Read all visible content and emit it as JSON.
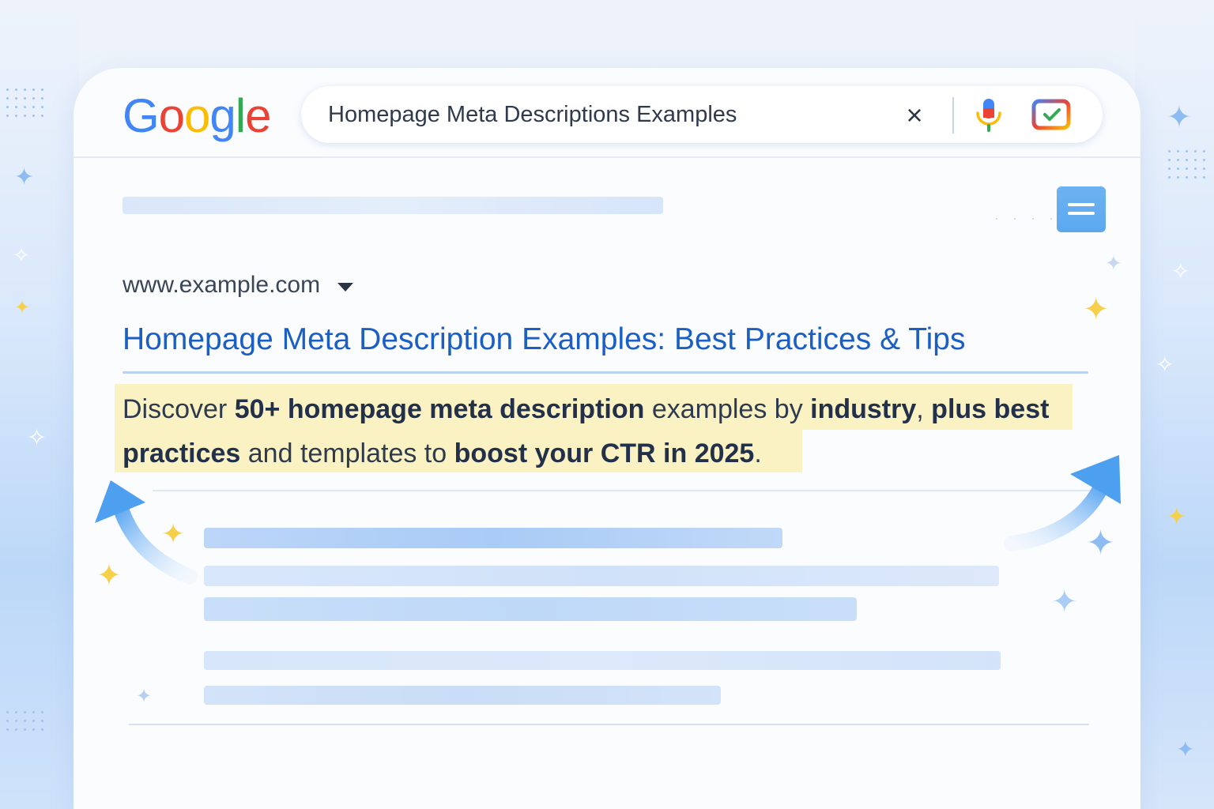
{
  "logo": {
    "letters": [
      "G",
      "o",
      "o",
      "g",
      "l",
      "e"
    ],
    "colors": [
      "#4285f4",
      "#ea4335",
      "#fbbc05",
      "#4285f4",
      "#34a853",
      "#ea4335"
    ]
  },
  "search": {
    "query": "Homepage Meta Descriptions Examples",
    "clear_icon": "×",
    "mic_icon": "microphone-icon",
    "lens_icon": "lens-icon"
  },
  "result": {
    "url": "www.example.com",
    "title": "Homepage Meta Description Examples: Best Practices & Tips",
    "snippet": [
      {
        "text": "Discover ",
        "bold": false
      },
      {
        "text": "50+ homepage meta description",
        "bold": true
      },
      {
        "text": " examples by ",
        "bold": false
      },
      {
        "text": "industry",
        "bold": true
      },
      {
        "text": ", ",
        "bold": false
      },
      {
        "text": "plus best practices",
        "bold": true
      },
      {
        "text": " and templates to ",
        "bold": false
      },
      {
        "text": "boost your CTR in 2025",
        "bold": true
      },
      {
        "text": ".",
        "bold": false
      }
    ]
  },
  "colors": {
    "title_link": "#1b5fc4",
    "highlight": "#fbf2c4",
    "accent_blue": "#5ca8ef",
    "sparkle_yellow": "#f6cf4b"
  },
  "icons": {
    "menu": "menu-icon",
    "arrow_left": "arrow-up-left-icon",
    "arrow_right": "arrow-up-right-icon",
    "sparkle": "sparkle-icon"
  }
}
